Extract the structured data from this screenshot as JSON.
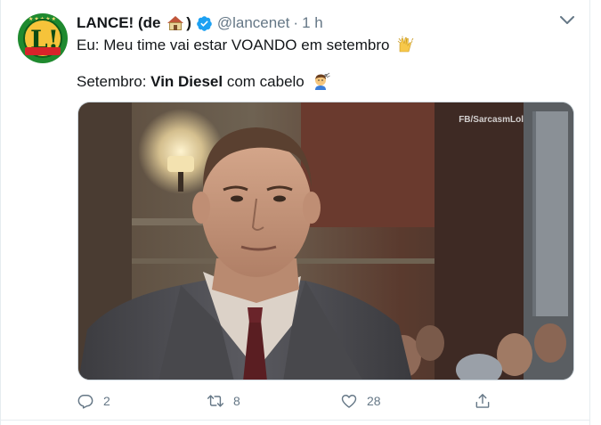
{
  "tweet": {
    "author_name_prefix": "LANCE! (de",
    "author_name_suffix": ")",
    "house_icon": "house-emoji",
    "verified_icon": "verified-badge-icon",
    "handle": "@lancenet",
    "separator": "·",
    "time": "1 h",
    "line1_text": "Eu: Meu time vai estar VOANDO em setembro",
    "line1_emoji": "raising-hands-emoji",
    "line2_prefix": "Setembro: ",
    "line2_bold": "Vin Diesel",
    "line2_suffix": " com cabelo",
    "line2_emoji": "haircut-emoji",
    "avatar_letter": "L!",
    "media_watermark": "FB/SarcasmLol"
  },
  "actions": {
    "reply_count": "2",
    "retweet_count": "8",
    "like_count": "28"
  },
  "colors": {
    "text": "#14171a",
    "secondary": "#657786",
    "verified": "#1da1f2",
    "border": "#e6ecf0"
  }
}
